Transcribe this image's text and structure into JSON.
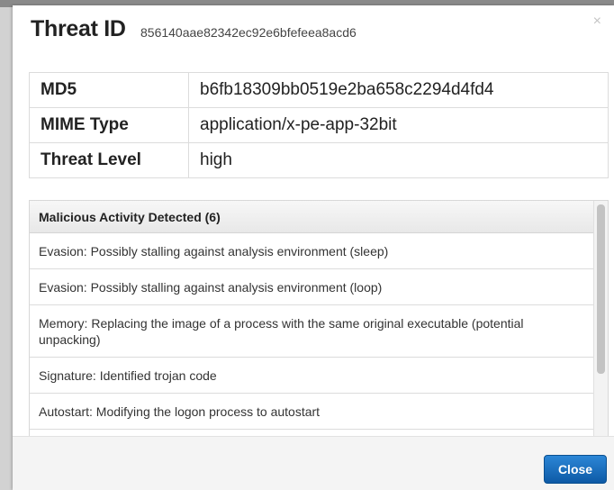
{
  "modal": {
    "title": "Threat ID",
    "threat_id": "856140aae82342ec92e6bfefeea8acd6",
    "close_x": "×"
  },
  "details": [
    {
      "label": "MD5",
      "value": "b6fb18309bb0519e2ba658c2294d4fd4"
    },
    {
      "label": "MIME Type",
      "value": "application/x-pe-app-32bit"
    },
    {
      "label": "Threat Level",
      "value": "high"
    }
  ],
  "activity": {
    "header": "Malicious Activity Detected (6)",
    "items": [
      "Evasion: Possibly stalling against analysis environment (sleep)",
      "Evasion: Possibly stalling against analysis environment (loop)",
      "Memory: Replacing the image of a process with the same original executable (potential unpacking)",
      "Signature: Identified trojan code",
      "Autostart: Modifying the logon process to autostart"
    ]
  },
  "footer": {
    "close_label": "Close"
  },
  "colors": {
    "primary_button": "#1a6fc0",
    "panel_border": "#dcdcdc"
  }
}
